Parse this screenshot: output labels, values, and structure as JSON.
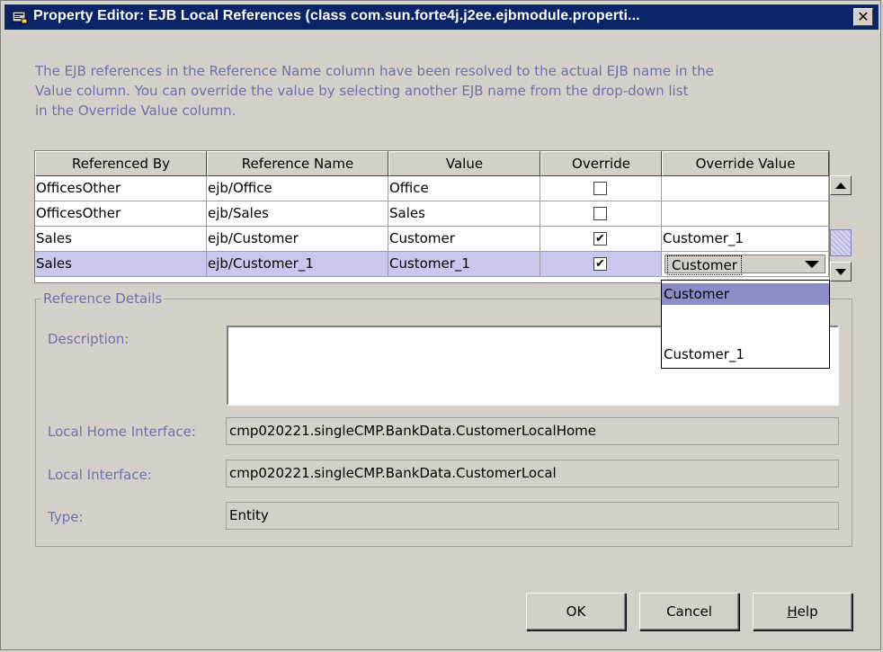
{
  "window": {
    "title": "Property Editor: EJB Local References (class com.sun.forte4j.j2ee.ejbmodule.properti...",
    "close_glyph": "✕"
  },
  "description_lines": [
    "The EJB references in the Reference Name column have been resolved to the actual EJB name in the",
    "Value column.  You can override the value by selecting another EJB name from the drop-down list",
    "in the Override Value column."
  ],
  "table": {
    "columns": [
      "Referenced By",
      "Reference Name",
      "Value",
      "Override",
      "Override Value"
    ],
    "rows": [
      {
        "referenced_by": "OfficesOther",
        "reference_name": "ejb/Office",
        "value": "Office",
        "override": false,
        "override_value": ""
      },
      {
        "referenced_by": "OfficesOther",
        "reference_name": "ejb/Sales",
        "value": "Sales",
        "override": false,
        "override_value": ""
      },
      {
        "referenced_by": "Sales",
        "reference_name": "ejb/Customer",
        "value": "Customer",
        "override": true,
        "override_value": "Customer_1"
      },
      {
        "referenced_by": "Sales",
        "reference_name": "ejb/Customer_1",
        "value": "Customer_1",
        "override": true,
        "override_value": "Customer"
      }
    ],
    "check_glyph": "✔",
    "dropdown_options": [
      "Customer",
      "",
      "Customer_1"
    ]
  },
  "details": {
    "legend": "Reference Details",
    "description_label": "Description:",
    "description_value": "",
    "local_home_label": "Local Home Interface:",
    "local_home_value": "cmp020221.singleCMP.BankData.CustomerLocalHome",
    "local_label": "Local Interface:",
    "local_value": "cmp020221.singleCMP.BankData.CustomerLocal",
    "type_label": "Type:",
    "type_value": "Entity"
  },
  "buttons": {
    "ok": "OK",
    "cancel": "Cancel",
    "help_mnemonic": "H",
    "help_rest": "elp"
  },
  "colors": {
    "title_bar": "#0a246a",
    "label_text": "#6f6fae",
    "selected_row": "#c8c8ee",
    "dropdown_highlight": "#8c8cc8"
  }
}
